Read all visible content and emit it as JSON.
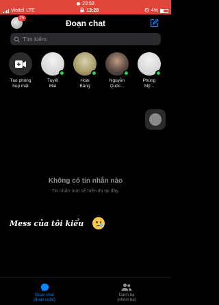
{
  "recording_bar": {
    "time": "23:58"
  },
  "status_bar": {
    "carrier": "Viettel",
    "network": "LTE",
    "time": "13:28",
    "battery": "4%"
  },
  "header": {
    "title": "Đoạn chat",
    "badge_count": "75"
  },
  "search": {
    "placeholder": "Tìm kiếm"
  },
  "stories": [
    {
      "line1": "Tạo phòng",
      "line2": "họp mặt"
    },
    {
      "line1": "Tuyết",
      "line2": "Mai"
    },
    {
      "line1": "Hoài",
      "line2": "Băng"
    },
    {
      "line1": "Nguyễn",
      "line2": "Quốc..."
    },
    {
      "line1": "Phùng",
      "line2": "Mỹ..."
    }
  ],
  "empty_state": {
    "title": "Không có tin nhắn nào",
    "subtitle": "Tin nhắn mới sẽ hiển thị tại đây."
  },
  "overlay_caption": "Mess của tôi kiểu",
  "tabs": [
    {
      "line1": "Đoạn chat",
      "line2": "(đoạn cuộc)"
    },
    {
      "line1": "Danh bạ",
      "line2": "(nhóm bạ)"
    }
  ],
  "colors": {
    "accent": "#0a84ff",
    "online": "#31d158",
    "badge": "#e63b3b",
    "recording": "#e0453a"
  }
}
